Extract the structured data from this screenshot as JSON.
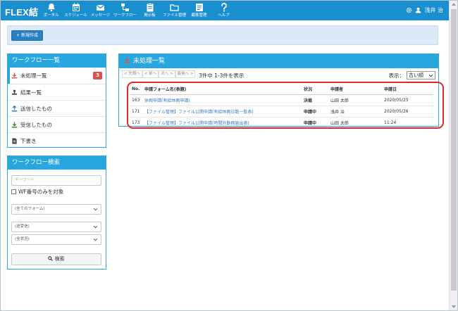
{
  "app": {
    "brand": "FLEX結"
  },
  "nav": [
    {
      "label": "ポータル",
      "icon": "bell-icon"
    },
    {
      "label": "スケジュール",
      "icon": "calendar-icon"
    },
    {
      "label": "メッセージ",
      "icon": "envelope-icon"
    },
    {
      "label": "ワークフロー",
      "icon": "workflow-icon"
    },
    {
      "label": "掲示板",
      "icon": "clipboard-icon"
    },
    {
      "label": "ファイル管理",
      "icon": "folder-icon"
    },
    {
      "label": "顧客管理",
      "icon": "customer-icon"
    },
    {
      "label": "ヘルプ",
      "icon": "help-icon"
    }
  ],
  "user": {
    "name": "浅井 治"
  },
  "toolbar": {
    "new_label": "新規作成"
  },
  "wf_list": {
    "title": "ワークフロー一覧",
    "items": [
      {
        "label": "未処理一覧",
        "badge": "3"
      },
      {
        "label": "結果一覧"
      },
      {
        "label": "送信したもの"
      },
      {
        "label": "受信したもの"
      },
      {
        "label": "下書き"
      }
    ]
  },
  "wf_search": {
    "title": "ワークフロー検索",
    "keyword_placeholder": "キーワード",
    "wf_only_label": "WF番号のみを対象",
    "form_select": "(全てのフォーム)",
    "direction_select": "(送受信)",
    "status_select": "(全状況)",
    "search_label": "検索"
  },
  "unprocessed": {
    "title": "未処理一覧",
    "pager": [
      "< 先頭へ",
      "< 前へ",
      "次へ >",
      "最後へ >"
    ],
    "count_text": "3件中 1-3件を表示",
    "display_label": "表示：",
    "sort_select": "古い順",
    "columns": {
      "no": "No.",
      "title": "申請フォーム名(表題)",
      "status": "状況",
      "applicant": "申請者",
      "date": "申請日"
    },
    "rows": [
      {
        "no": "163",
        "title": "休暇申請(有給休暇申請)",
        "status": "決裁",
        "applicant": "山田 太郎",
        "date": "2020/05/25"
      },
      {
        "no": "171",
        "title": "【ファイル管理】ファイル公開申請(有給休暇日数一覧表)",
        "status": "申請中",
        "applicant": "浅井 治",
        "date": "2020/05/26"
      },
      {
        "no": "173",
        "title": "【ファイル管理】ファイル公開申請(時間外勤務届出表)",
        "status": "申請中",
        "applicant": "山田 太郎",
        "date": "11:24"
      }
    ]
  },
  "colors": {
    "nav_bg": "#1a8fd0",
    "panel_head": "#2aa6de",
    "badge": "#d9534f",
    "highlight": "#e3262c",
    "status_done": "#2e8b3a",
    "status_progress": "#2a6eb5"
  }
}
